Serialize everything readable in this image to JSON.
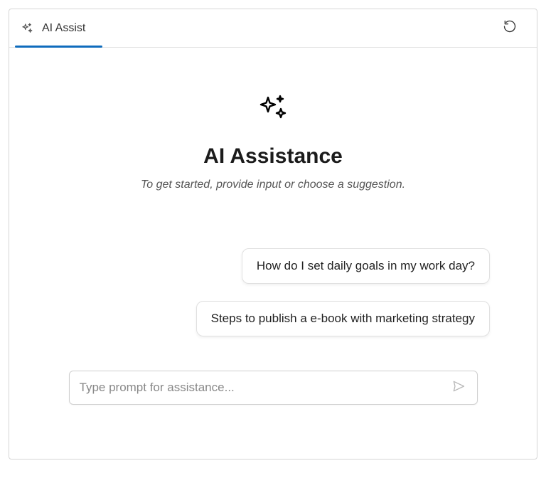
{
  "tab": {
    "label": "AI Assist"
  },
  "hero": {
    "title": "AI Assistance",
    "subtitle": "To get started, provide input or choose a suggestion."
  },
  "suggestions": [
    "How do I set daily goals in my work day?",
    "Steps to publish a e-book with marketing strategy"
  ],
  "input": {
    "placeholder": "Type prompt for assistance...",
    "value": ""
  }
}
